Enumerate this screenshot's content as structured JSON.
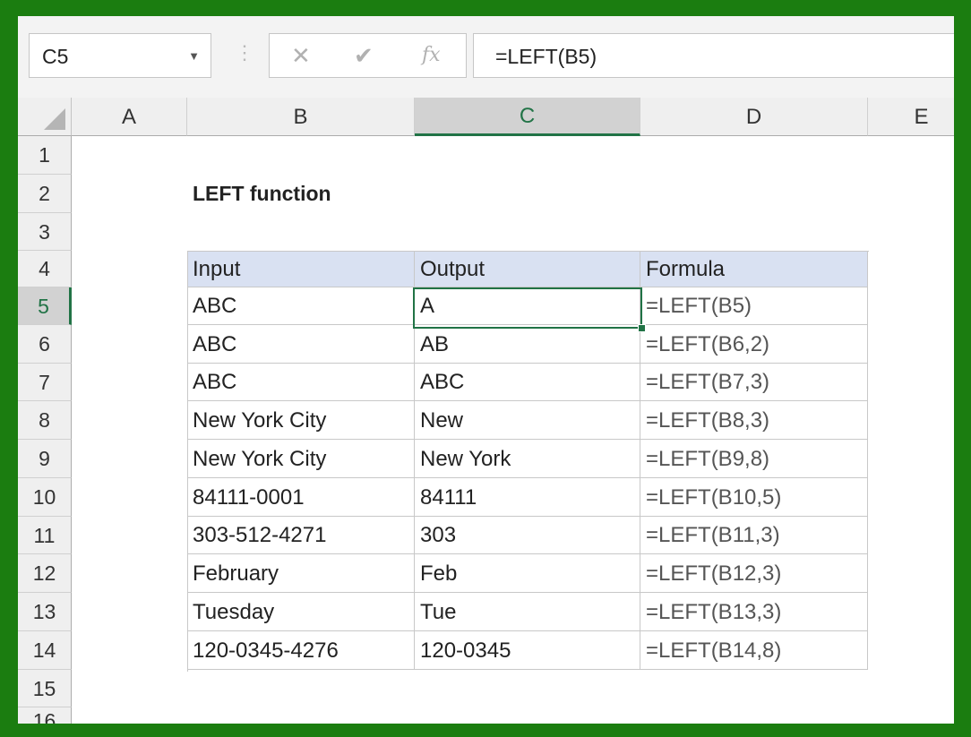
{
  "formula_bar": {
    "name_box": "C5",
    "cancel_icon": "✕",
    "enter_icon": "✔",
    "fx_icon": "fx",
    "formula": "=LEFT(B5)"
  },
  "columns": [
    "A",
    "B",
    "C",
    "D",
    "E"
  ],
  "selected_column": "C",
  "rows": [
    "1",
    "2",
    "3",
    "4",
    "5",
    "6",
    "7",
    "8",
    "9",
    "10",
    "11",
    "12",
    "13",
    "14",
    "15",
    "16"
  ],
  "selected_row": "5",
  "sheet": {
    "title": "LEFT function",
    "headers": [
      "Input",
      "Output",
      "Formula"
    ],
    "data": [
      [
        "ABC",
        "A",
        "=LEFT(B5)"
      ],
      [
        "ABC",
        "AB",
        "=LEFT(B6,2)"
      ],
      [
        "ABC",
        "ABC",
        "=LEFT(B7,3)"
      ],
      [
        "New York City",
        "New",
        "=LEFT(B8,3)"
      ],
      [
        "New York City",
        "New York",
        "=LEFT(B9,8)"
      ],
      [
        "84111-0001",
        "84111",
        "=LEFT(B10,5)"
      ],
      [
        "303-512-4271",
        "303",
        "=LEFT(B11,3)"
      ],
      [
        "February",
        "Feb",
        "=LEFT(B12,3)"
      ],
      [
        "Tuesday",
        "Tue",
        "=LEFT(B13,3)"
      ],
      [
        "120-0345-4276",
        "120-0345",
        "=LEFT(B14,8)"
      ]
    ]
  },
  "colors": {
    "frame": "#1b7d10",
    "accent": "#217346",
    "table_header_fill": "#d9e1f2"
  }
}
